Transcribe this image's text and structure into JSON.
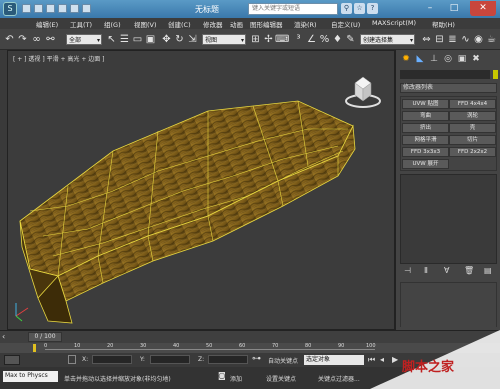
{
  "window": {
    "title": "无标题",
    "search_placeholder": "键入关键字或短语"
  },
  "menu": [
    "编辑(E)",
    "工具(T)",
    "组(G)",
    "视图(V)",
    "创建(C)",
    "修改器",
    "动画",
    "图形编辑器",
    "渲染(R)",
    "自定义(U)",
    "MAXScript(M)",
    "帮助(H)"
  ],
  "toolbar": {
    "filter_select": "全部",
    "coord_select": "视图",
    "selection_set_select": "创建选择集"
  },
  "viewport": {
    "label": "[ + ] 透视 ] 平滑 + 高光 + 边面 ]"
  },
  "command_panel": {
    "modifier_list": "修改器列表",
    "buttons": [
      [
        "UVW 贴图",
        "FFD 4x4x4"
      ],
      [
        "弯曲",
        "涡轮"
      ],
      [
        "挤出",
        "壳"
      ],
      [
        "网格平滑",
        "切片"
      ],
      [
        "FFD 3x3x3",
        "FFD 2x2x2"
      ],
      [
        "UVW 展开",
        ""
      ]
    ]
  },
  "timeline": {
    "frame_label": "0 / 100"
  },
  "ticks": [
    "0",
    "10",
    "20",
    "30",
    "40",
    "50",
    "60",
    "70",
    "80",
    "90",
    "100"
  ],
  "status": {
    "maxscript_label": "Max to Physcs",
    "x_label": "X:",
    "y_label": "Y:",
    "z_label": "Z:",
    "autokey": "自动关键点",
    "selected": "选定对象",
    "set_key": "设置关键点",
    "key_filter": "关键点过滤器...",
    "add": "添加",
    "prompt": "单击并拖动以选择并缩放对象(非均匀地)"
  },
  "colors": {
    "wood_light": "#8a6a1e",
    "wood_dark": "#5a4210",
    "wire": "#e8d840",
    "titlebar": "#4a88ba"
  }
}
